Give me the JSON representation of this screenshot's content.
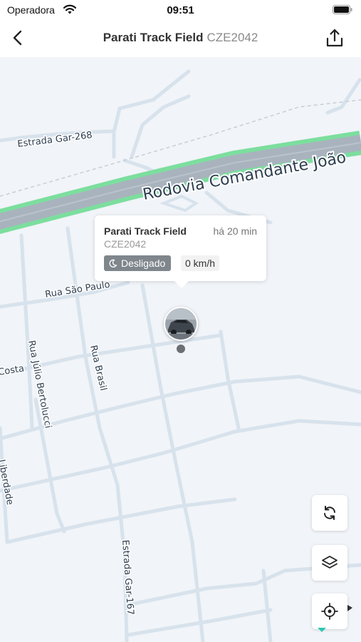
{
  "status_bar": {
    "carrier": "Operadora",
    "time": "09:51"
  },
  "header": {
    "title": "Parati Track Field",
    "plate": "CZE2042"
  },
  "map": {
    "road_labels": {
      "highway": "Rodovia Comandante João",
      "estrada_gar_268": "Estrada Gar-268",
      "rua_sao_paulo": "Rua São Paulo",
      "costa": "Costa",
      "rua_julio_bertolucci": "Rua Júlio Bertolucci",
      "rua_brasil": "Rua Brasil",
      "liberdade": "Liberdade",
      "estrada_gar_167": "Estrada Gar-167"
    },
    "colors": {
      "background": "#f1f4f8",
      "road": "#d7e2ec",
      "highway_border": "#7cde9e",
      "highway_fill": "#a9b3be"
    }
  },
  "popup": {
    "vehicle_name": "Parati Track Field",
    "last_update": "há 20 min",
    "plate": "CZE2042",
    "status": "Desligado",
    "speed": "0 km/h"
  },
  "controls": {
    "refresh_icon": "refresh-icon",
    "layers_icon": "layers-icon",
    "locate_icon": "crosshair-icon"
  }
}
